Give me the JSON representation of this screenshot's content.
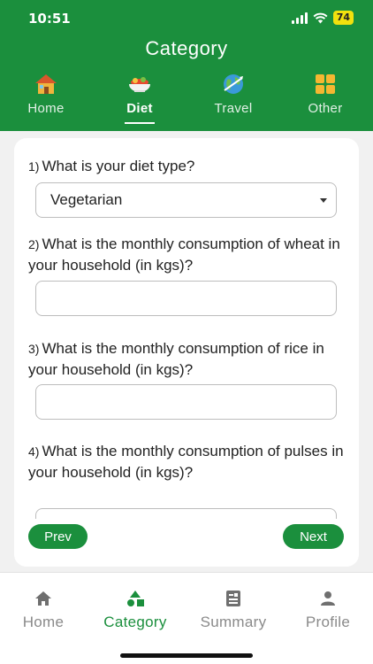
{
  "status_bar": {
    "time": "10:51",
    "battery": "74"
  },
  "header": {
    "title": "Category"
  },
  "category_tabs": [
    {
      "label": "Home",
      "icon": "house-icon",
      "active": false
    },
    {
      "label": "Diet",
      "icon": "food-bowl-icon",
      "active": true
    },
    {
      "label": "Travel",
      "icon": "globe-icon",
      "active": false
    },
    {
      "label": "Other",
      "icon": "grid-icon",
      "active": false
    }
  ],
  "questions": [
    {
      "number": "1)",
      "text": "What is your diet type?",
      "type": "select",
      "value": "Vegetarian"
    },
    {
      "number": "2)",
      "text": "What is the monthly consumption of wheat in your household (in kgs)?",
      "type": "input",
      "value": ""
    },
    {
      "number": "3)",
      "text": "What is the monthly consumption of rice in your household (in kgs)?",
      "type": "input",
      "value": ""
    },
    {
      "number": "4)",
      "text": "What is the monthly consumption of pulses in your household (in kgs)?",
      "type": "input",
      "value": ""
    }
  ],
  "actions": {
    "prev_label": "Prev",
    "next_label": "Next"
  },
  "bottom_nav": [
    {
      "label": "Home",
      "icon": "home-icon",
      "active": false
    },
    {
      "label": "Category",
      "icon": "shapes-icon",
      "active": true
    },
    {
      "label": "Summary",
      "icon": "summary-icon",
      "active": false
    },
    {
      "label": "Profile",
      "icon": "person-icon",
      "active": false
    }
  ],
  "colors": {
    "primary": "#1b8f3d",
    "inactive": "#8a8a8a",
    "background": "#f1f1f1"
  }
}
